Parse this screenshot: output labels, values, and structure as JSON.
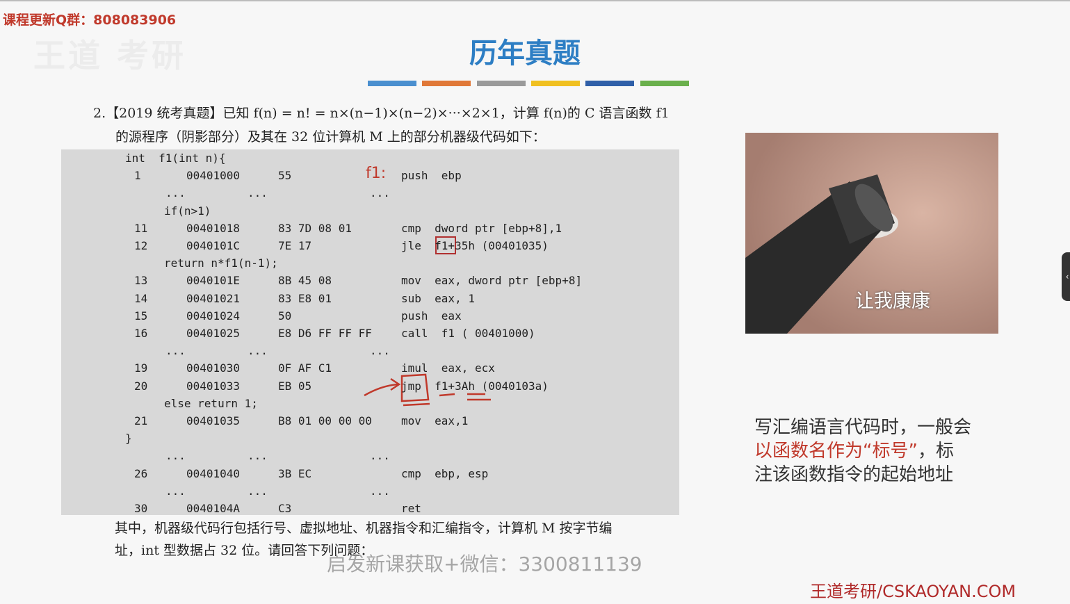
{
  "header": {
    "qq_banner": "课程更新Q群：808083906",
    "ghost_logo": "王道 考研",
    "title": "历年真题"
  },
  "color_bars": [
    "#4a8fcf",
    "#e07838",
    "#9a9a9a",
    "#f0c020",
    "#2f5fa8",
    "#6ab04c"
  ],
  "question": {
    "line1": "2.【2019 统考真题】已知 f(n) = n! = n×(n−1)×(n−2)×···×2×1，计算 f(n)的 C 语言函数 f1",
    "line2": "的源程序（阴影部分）及其在 32 位计算机 M 上的部分机器级代码如下："
  },
  "code": {
    "f1_label": "f1:",
    "lines": [
      {
        "src": "int  f1(int n){"
      },
      {
        "num": "1",
        "addr": "00401000",
        "mc": "55",
        "asm": "push  ebp"
      },
      {
        "num": "...",
        "addr": "...",
        "mc": "",
        "asm": "..."
      },
      {
        "src": "if(n>1)"
      },
      {
        "num": "11",
        "addr": "00401018",
        "mc": "83 7D 08 01",
        "asm": "cmp  dword ptr [ebp+8],1"
      },
      {
        "num": "12",
        "addr": "0040101C",
        "mc": "7E 17",
        "asm": "jle  f1+35h (00401035)"
      },
      {
        "src": "return n*f1(n-1);"
      },
      {
        "num": "13",
        "addr": "0040101E",
        "mc": "8B 45 08",
        "asm": "mov  eax, dword ptr [ebp+8]"
      },
      {
        "num": "14",
        "addr": "00401021",
        "mc": "83 E8 01",
        "asm": "sub  eax, 1"
      },
      {
        "num": "15",
        "addr": "00401024",
        "mc": "50",
        "asm": "push  eax"
      },
      {
        "num": "16",
        "addr": "00401025",
        "mc": "E8 D6 FF FF FF",
        "asm": "call  f1 ( 00401000)"
      },
      {
        "num": "...",
        "addr": "...",
        "mc": "",
        "asm": "..."
      },
      {
        "num": "19",
        "addr": "00401030",
        "mc": "0F AF C1",
        "asm": "imul  eax, ecx"
      },
      {
        "num": "20",
        "addr": "00401033",
        "mc": "EB 05",
        "asm": "jmp  f1+3Ah (0040103a)"
      },
      {
        "src": "else return 1;"
      },
      {
        "num": "21",
        "addr": "00401035",
        "mc": "B8 01 00 00 00",
        "asm": "mov  eax,1"
      },
      {
        "src": "}"
      },
      {
        "num": "...",
        "addr": "...",
        "mc": "",
        "asm": "..."
      },
      {
        "num": "26",
        "addr": "00401040",
        "mc": "3B EC",
        "asm": "cmp  ebp, esp"
      },
      {
        "num": "...",
        "addr": "...",
        "mc": "",
        "asm": "..."
      },
      {
        "num": "30",
        "addr": "0040104A",
        "mc": "C3",
        "asm": "ret"
      }
    ]
  },
  "description": {
    "line1": "其中，机器级代码行包括行号、虚拟地址、机器指令和汇编指令，计算机 M 按字节编",
    "line2": "址，int 型数据占 32 位。请回答下列问题："
  },
  "video": {
    "caption": "让我康康"
  },
  "side_note": {
    "part1": "写汇编语言代码时，一般会",
    "part2_red": "以函数名作为“标号”",
    "part3": "，标",
    "part4": "注该函数指令的起始地址"
  },
  "watermark": "启发新课获取+微信：3300811139",
  "brand": "王道考研/CSKAOYAN.COM",
  "edge_tab_icon": "‹"
}
